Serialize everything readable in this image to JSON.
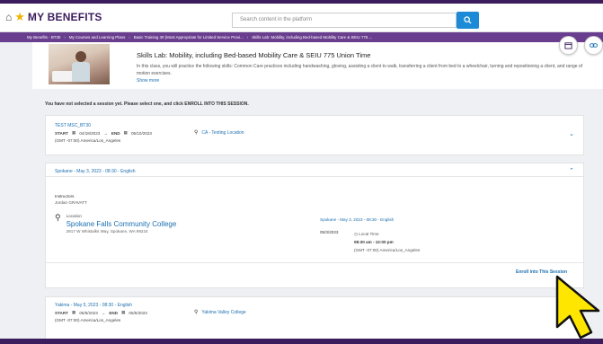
{
  "header": {
    "brand": "MY BENEFITS",
    "search_placeholder": "Search content in the platform"
  },
  "breadcrumbs": [
    "My Benefits - BT30",
    "My Courses and Learning Plans",
    "Basic Training 30 (Most Appropriate for Limited Service Provi...",
    "Skills Lab: Mobility, including Bed-based Mobility Care & SEIU 775 ..."
  ],
  "course": {
    "title": "Skills Lab: Mobility, including Bed-based Mobility Care & SEIU 775 Union Time",
    "description": "In this class, you will practice the following skills: Common Care practices including handwashing, gloving, assisting a client to walk, transferring a client from bed to a wheelchair, turning and repositioning a client, and range of motion exercises.",
    "show_more": "Show more"
  },
  "notice": "You have not selected a session yet. Please select one, and click ENROLL INTO THIS SESSION.",
  "sessions": [
    {
      "title": "TEST MSC_BT30",
      "start_label": "START",
      "start_date": "04/18/2023",
      "end_label": "END",
      "end_date": "05/10/2023",
      "timezone": "(GMT -07:00) America/Los_Angeles",
      "location": "CA - Testing Location"
    },
    {
      "title": "Spokane - May 3, 2023 - 08:30 - English",
      "instructors_label": "Instructors",
      "instructor": "Jordan GRAVATT",
      "location_label": "Location",
      "location_name": "Spokane Falls Community College",
      "location_address": "2917 W Whistalks Way, Spokane, WA 99224",
      "detail_title": "Spokane - May 3, 2023 - 08:30 - English",
      "detail_date": "05/3/2023",
      "local_time_label": "Local Time",
      "time_range": "08:30 am - 12:00 pm",
      "timezone": "(GMT -07:00) America/Los_Angeles",
      "enroll_label": "Enroll into This Session"
    },
    {
      "title": "Yakima - May 5, 2023 - 08:30 - English",
      "start_label": "START",
      "start_date": "05/5/2023",
      "end_label": "END",
      "end_date": "05/5/2023",
      "timezone": "(GMT -07:00) America/Los_Angeles",
      "location": "Yakima Valley College"
    }
  ],
  "colors": {
    "brand_purple": "#3b1d5e",
    "breadcrumb_purple": "#6a3e8f",
    "link_blue": "#1c6fb0",
    "search_blue": "#1c8ad6",
    "cursor_yellow": "#ffe600"
  }
}
